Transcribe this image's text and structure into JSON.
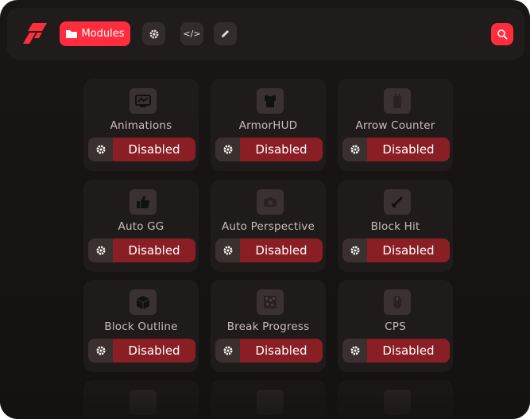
{
  "topbar": {
    "modules_label": "Modules",
    "settings_icon": "gear-icon",
    "code_label": "</>",
    "edit_icon": "pencil-icon",
    "search_icon": "search-icon"
  },
  "colors": {
    "accent": "#ff2d3d",
    "disabled": "#8a1e25",
    "card": "#201b1b"
  },
  "modules": [
    {
      "name": "Animations",
      "state": "Disabled",
      "icon": "animation-icon"
    },
    {
      "name": "ArmorHUD",
      "state": "Disabled",
      "icon": "armor-icon"
    },
    {
      "name": "Arrow Counter",
      "state": "Disabled",
      "icon": "quiver-icon"
    },
    {
      "name": "Auto GG",
      "state": "Disabled",
      "icon": "thumbs-up-icon"
    },
    {
      "name": "Auto Perspective",
      "state": "Disabled",
      "icon": "camera-icon"
    },
    {
      "name": "Block Hit",
      "state": "Disabled",
      "icon": "sword-icon"
    },
    {
      "name": "Block Outline",
      "state": "Disabled",
      "icon": "cube-icon"
    },
    {
      "name": "Break Progress",
      "state": "Disabled",
      "icon": "pattern-icon"
    },
    {
      "name": "CPS",
      "state": "Disabled",
      "icon": "mouse-icon"
    }
  ]
}
